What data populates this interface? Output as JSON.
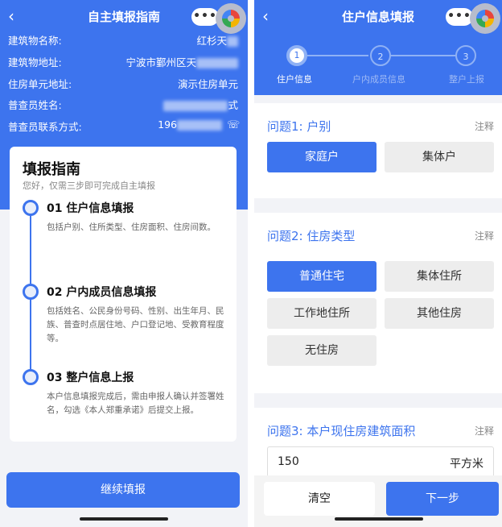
{
  "left": {
    "nav": {
      "back": "‹",
      "title": "自主填报指南",
      "more": "•••"
    },
    "info": [
      {
        "label": "建筑物名称:",
        "value": "红杉天"
      },
      {
        "label": "建筑物地址:",
        "value": "宁波市鄞州区天"
      },
      {
        "label": "住房单元地址:",
        "value": "演示住房单元"
      },
      {
        "label": "普查员姓名:",
        "value": "式"
      },
      {
        "label": "普查员联系方式:",
        "value": "196"
      }
    ],
    "guide": {
      "title": "填报指南",
      "subtitle": "您好，仅需三步即可完成自主填报",
      "steps": [
        {
          "title": "01 住户信息填报",
          "desc": "包括户别、住所类型、住房面积、住房间数。"
        },
        {
          "title": "02 户内成员信息填报",
          "desc": "包括姓名、公民身份号码、性别、出生年月、民族、普查时点居住地、户口登记地、受教育程度等。"
        },
        {
          "title": "03 整户信息上报",
          "desc": "本户信息填报完成后，需由申报人确认并签署姓名，勾选《本人郑重承诺》后提交上报。"
        }
      ]
    },
    "continue_label": "继续填报"
  },
  "right": {
    "nav": {
      "back": "‹",
      "title": "住户信息填报",
      "more": "•••"
    },
    "stepper": [
      {
        "num": "1",
        "label": "住户信息"
      },
      {
        "num": "2",
        "label": "户内成员信息"
      },
      {
        "num": "3",
        "label": "整户上报"
      }
    ],
    "q1": {
      "title": "问题1: 户别",
      "note": "注释",
      "options": [
        "家庭户",
        "集体户"
      ],
      "selected": "家庭户"
    },
    "q2": {
      "title": "问题2: 住房类型",
      "note": "注释",
      "options": [
        "普通住宅",
        "集体住所",
        "工作地住所",
        "其他住房",
        "无住房"
      ],
      "selected": "普通住宅"
    },
    "q3": {
      "title": "问题3: 本户现住房建筑面积",
      "note": "注释",
      "value": "150",
      "unit": "平方米"
    },
    "clear_label": "清空",
    "next_label": "下一步"
  }
}
